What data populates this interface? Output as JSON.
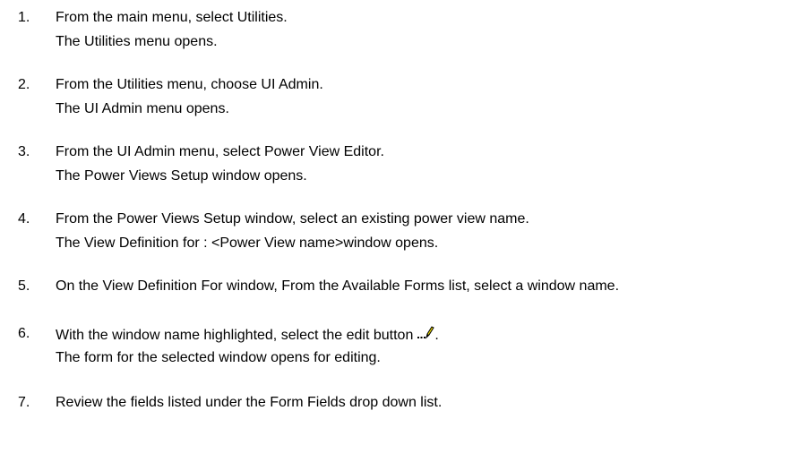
{
  "steps": [
    {
      "number": "1.",
      "instruction": "From the main menu, select Utilities.",
      "result": "The Utilities menu opens."
    },
    {
      "number": "2.",
      "instruction": "From the Utilities menu, choose UI Admin.",
      "result": "The UI Admin menu opens."
    },
    {
      "number": "3.",
      "instruction": "From the UI Admin menu, select Power View Editor.",
      "result": "The Power Views Setup window opens."
    },
    {
      "number": "4.",
      "instruction": "From the Power Views Setup window,  select an existing power view name.",
      "result": "The View Definition for : <Power View name>window opens."
    },
    {
      "number": "5.",
      "instruction": "On the View Definition For window, From the Available Forms list, select a window name."
    },
    {
      "number": "6.",
      "instruction": "With the window name highlighted, select the edit button",
      "instruction_end": ".",
      "icon": "edit-pencil-icon",
      "result": "The form for the selected window opens for editing."
    },
    {
      "number": "7.",
      "instruction": "Review the fields listed under the Form Fields drop down list."
    }
  ]
}
